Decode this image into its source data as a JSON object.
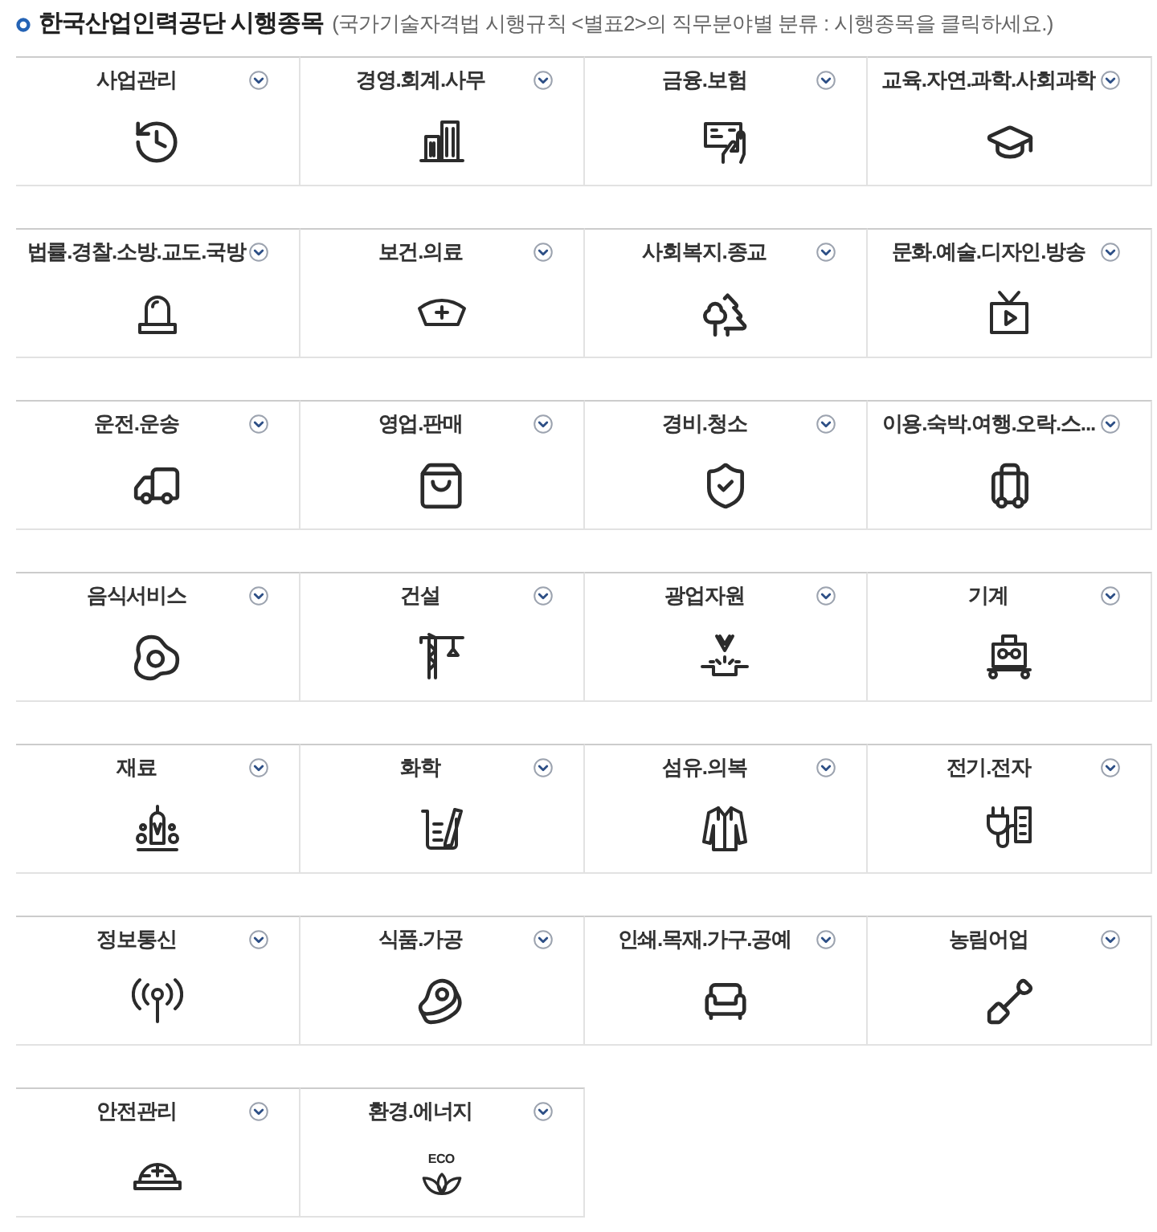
{
  "header": {
    "title": "한국산업인력공단 시행종목",
    "note": "(국가기술자격법 시행규칙 <별표2>의 직무분야별 분류 : 시행종목을 클릭하세요.)"
  },
  "categories": [
    {
      "label": "사업관리",
      "expanded": false
    },
    {
      "label": "경영.회계.사무",
      "expanded": false
    },
    {
      "label": "금융.보험",
      "expanded": false
    },
    {
      "label": "교육.자연.과학.사회과학",
      "expanded": false
    },
    {
      "label": "법률.경찰.소방.교도.국방",
      "expanded": false
    },
    {
      "label": "보건.의료",
      "expanded": false
    },
    {
      "label": "사회복지.종교",
      "expanded": false
    },
    {
      "label": "문화.예술.디자인.방송",
      "expanded": false
    },
    {
      "label": "운전.운송",
      "expanded": false
    },
    {
      "label": "영업.판매",
      "expanded": false
    },
    {
      "label": "경비.청소",
      "expanded": false
    },
    {
      "label": "이용.숙박.여행.오락.스...",
      "expanded": false
    },
    {
      "label": "음식서비스",
      "expanded": false
    },
    {
      "label": "건설",
      "expanded": false
    },
    {
      "label": "광업자원",
      "expanded": false
    },
    {
      "label": "기계",
      "expanded": false
    },
    {
      "label": "재료",
      "expanded": false
    },
    {
      "label": "화학",
      "expanded": false
    },
    {
      "label": "섬유.의복",
      "expanded": false
    },
    {
      "label": "전기.전자",
      "expanded": false
    },
    {
      "label": "정보통신",
      "expanded": false
    },
    {
      "label": "식품.가공",
      "expanded": false
    },
    {
      "label": "인쇄.목재.가구.공예",
      "expanded": false
    },
    {
      "label": "농림어업",
      "expanded": false
    },
    {
      "label": "안전관리",
      "expanded": false
    },
    {
      "label": "환경.에너지",
      "expanded": false,
      "icon_text": "ECO"
    }
  ]
}
